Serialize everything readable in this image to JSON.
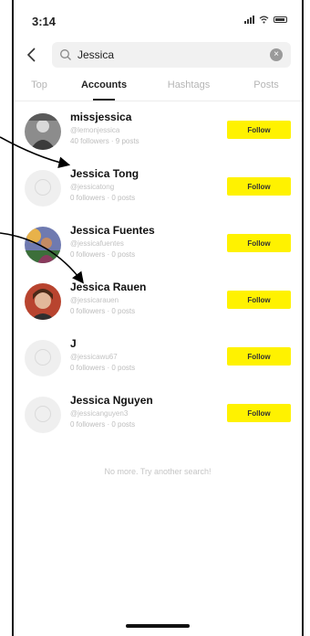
{
  "status_bar": {
    "time": "3:14"
  },
  "search": {
    "value": "Jessica",
    "placeholder": "Search"
  },
  "tabs": [
    {
      "label": "Top",
      "active": false
    },
    {
      "label": "Accounts",
      "active": true
    },
    {
      "label": "Hashtags",
      "active": false
    },
    {
      "label": "Posts",
      "active": false
    }
  ],
  "accounts": [
    {
      "name": "missjessica",
      "handle": "@lemonjessica",
      "stats": "40 followers · 9 posts",
      "follow_label": "Follow"
    },
    {
      "name": "Jessica Tong",
      "handle": "@jessicatong",
      "stats": "0 followers · 0 posts",
      "follow_label": "Follow"
    },
    {
      "name": "Jessica Fuentes",
      "handle": "@jessicafuentes",
      "stats": "0 followers · 0 posts",
      "follow_label": "Follow"
    },
    {
      "name": "Jessica Rauen",
      "handle": "@jessicarauen",
      "stats": "0 followers · 0 posts",
      "follow_label": "Follow"
    },
    {
      "name": "J",
      "handle": "@jessicawu67",
      "stats": "0 followers · 0 posts",
      "follow_label": "Follow"
    },
    {
      "name": "Jessica Nguyen",
      "handle": "@jessicanguyen3",
      "stats": "0 followers · 0 posts",
      "follow_label": "Follow"
    }
  ],
  "footer_message": "No more. Try another search!",
  "colors": {
    "follow_button": "#fff200",
    "annotation_arrow": "#000000"
  }
}
